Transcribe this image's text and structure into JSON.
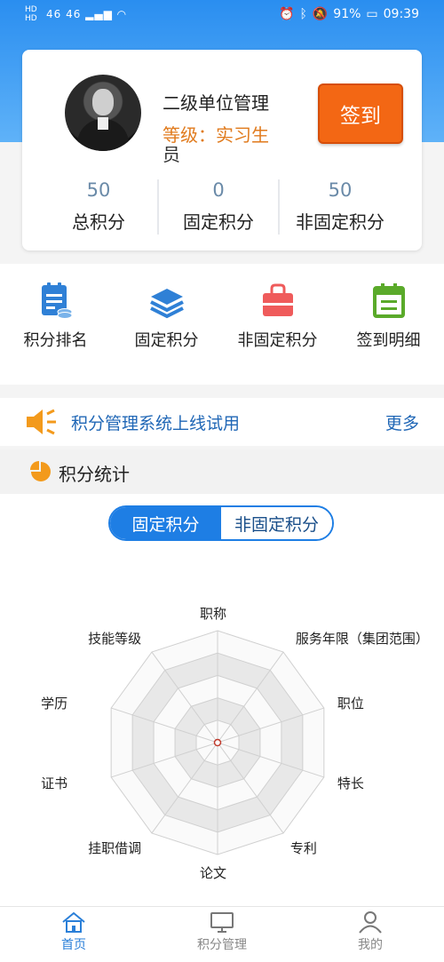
{
  "status_bar": {
    "left_badges": [
      "HD",
      "HD"
    ],
    "signal": "46 46",
    "battery": "91%",
    "time": "09:39"
  },
  "profile": {
    "unit_name": "二级单位管理",
    "level_label": "等级：实习生",
    "unit_name_wrap": "员",
    "signin_label": "签到"
  },
  "stats": [
    {
      "value": "50",
      "label": "总积分"
    },
    {
      "value": "0",
      "label": "固定积分"
    },
    {
      "value": "50",
      "label": "非固定积分"
    }
  ],
  "menu": [
    {
      "label": "积分排名",
      "icon": "ranking-doc-icon",
      "color": "#2f80d6"
    },
    {
      "label": "固定积分",
      "icon": "layers-icon",
      "color": "#2f80d6"
    },
    {
      "label": "非固定积分",
      "icon": "bag-icon",
      "color": "#ef5b5b"
    },
    {
      "label": "签到明细",
      "icon": "calendar-icon",
      "color": "#5aaa2a"
    }
  ],
  "notice": {
    "text": "积分管理系统上线试用",
    "more_label": "更多"
  },
  "section": {
    "title": "积分统计"
  },
  "segment": {
    "active": "固定积分",
    "inactive": "非固定积分"
  },
  "chart_data": {
    "type": "radar",
    "axes": [
      "职称",
      "服务年限（集团范围）",
      "职位",
      "特长",
      "专利",
      "论文",
      "挂职借调",
      "证书",
      "学历",
      "技能等级"
    ],
    "values": [
      0,
      0,
      0,
      0,
      0,
      0,
      0,
      0,
      0,
      0
    ],
    "rings": 5
  },
  "tabs": [
    {
      "label": "首页",
      "icon": "home-icon",
      "active": true
    },
    {
      "label": "积分管理",
      "icon": "monitor-icon",
      "active": false
    },
    {
      "label": "我的",
      "icon": "user-icon",
      "active": false
    }
  ]
}
